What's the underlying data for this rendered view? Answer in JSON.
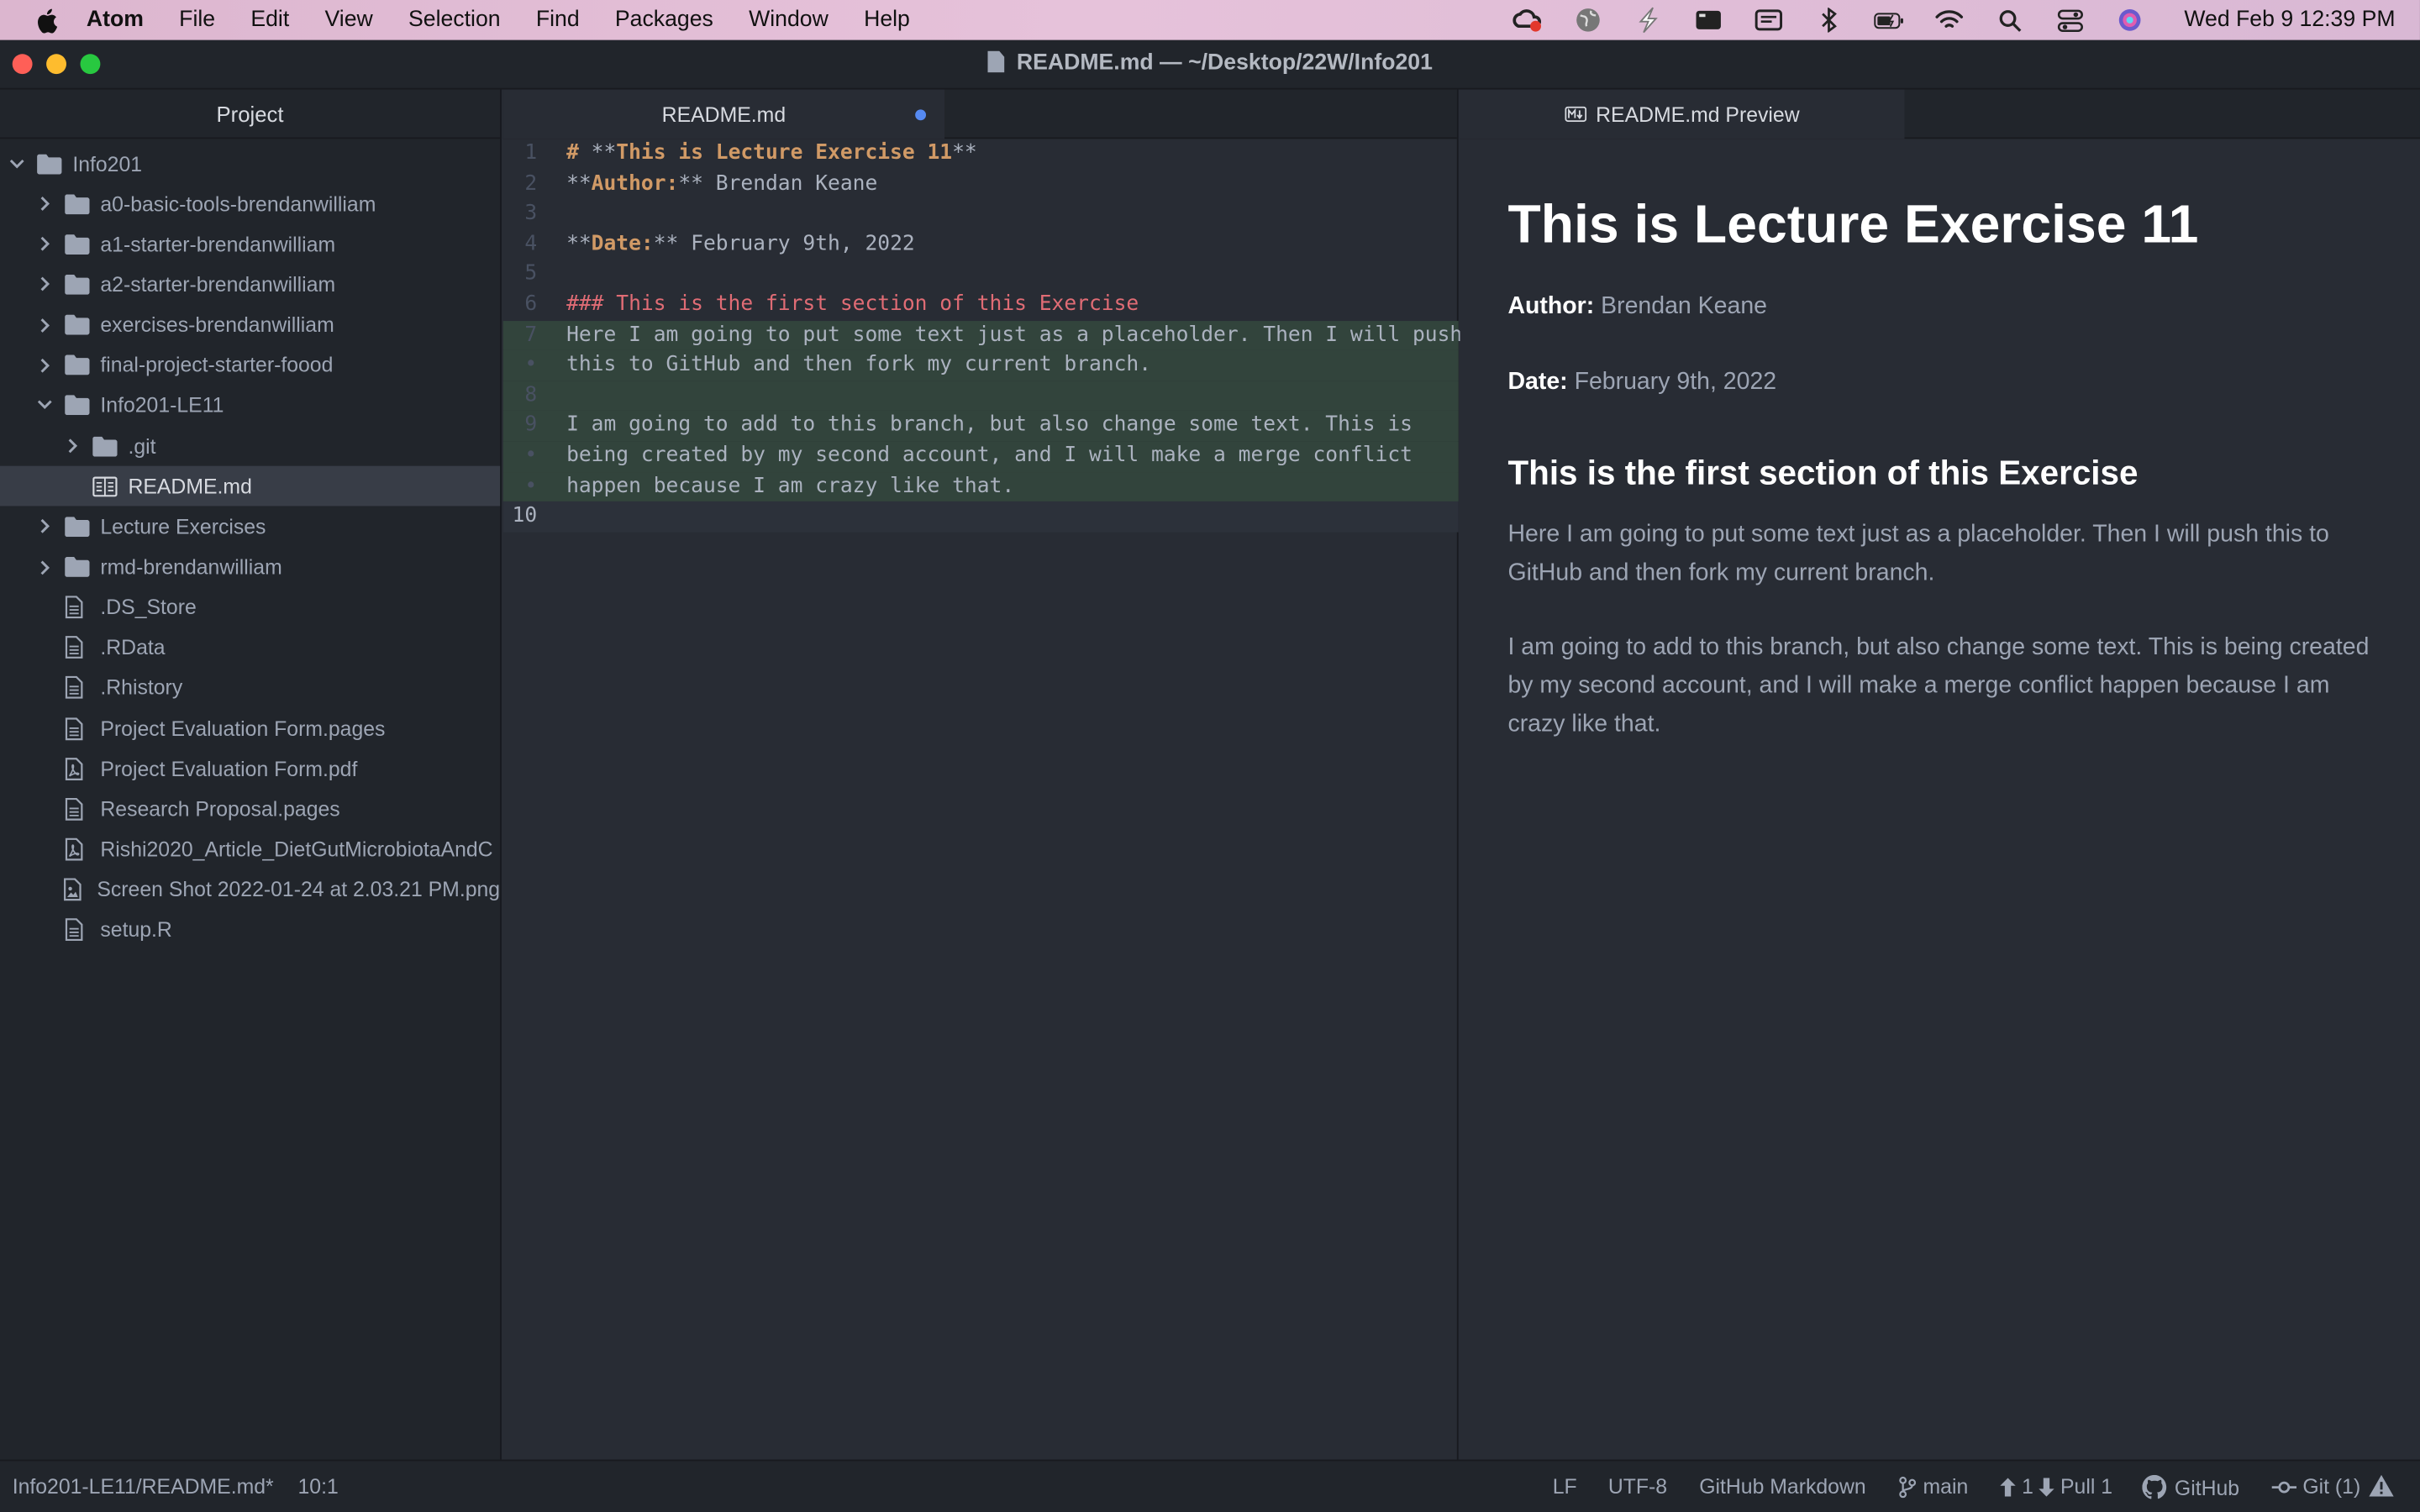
{
  "menubar": {
    "items": [
      "Atom",
      "File",
      "Edit",
      "View",
      "Selection",
      "Find",
      "Packages",
      "Window",
      "Help"
    ],
    "clock": "Wed Feb 9  12:39 PM"
  },
  "window": {
    "title": "README.md — ~/Desktop/22W/Info201"
  },
  "tree": {
    "header": "Project",
    "rows": [
      {
        "label": "Info201",
        "type": "folder-open"
      },
      {
        "label": "a0-basic-tools-brendanwilliam",
        "type": "folder"
      },
      {
        "label": "a1-starter-brendanwilliam",
        "type": "folder"
      },
      {
        "label": "a2-starter-brendanwilliam",
        "type": "folder"
      },
      {
        "label": "exercises-brendanwilliam",
        "type": "folder"
      },
      {
        "label": "final-project-starter-foood",
        "type": "folder"
      },
      {
        "label": "Info201-LE11",
        "type": "folder-open"
      },
      {
        "label": ".git",
        "type": "folder"
      },
      {
        "label": "README.md",
        "type": "markdown-file"
      },
      {
        "label": "Lecture Exercises",
        "type": "folder"
      },
      {
        "label": "rmd-brendanwilliam",
        "type": "folder"
      },
      {
        "label": ".DS_Store",
        "type": "file"
      },
      {
        "label": ".RData",
        "type": "file"
      },
      {
        "label": ".Rhistory",
        "type": "file"
      },
      {
        "label": "Project Evaluation Form.pages",
        "type": "file"
      },
      {
        "label": "Project Evaluation Form.pdf",
        "type": "pdf-file"
      },
      {
        "label": "Research Proposal.pages",
        "type": "file"
      },
      {
        "label": "Rishi2020_Article_DietGutMicrobiotaAndC",
        "type": "pdf-file"
      },
      {
        "label": "Screen Shot 2022-01-24 at 2.03.21 PM.png",
        "type": "image-file"
      },
      {
        "label": "setup.R",
        "type": "file"
      }
    ]
  },
  "editor": {
    "tab_label": "README.md",
    "lines": {
      "l1": {
        "num": "1",
        "a": "# ",
        "b": "**",
        "c": "This is Lecture Exercise 11",
        "d": "**"
      },
      "l2": {
        "num": "2",
        "a": "**",
        "b": "Author:",
        "c": "** Brendan Keane"
      },
      "l3": {
        "num": "3"
      },
      "l4": {
        "num": "4",
        "a": "**",
        "b": "Date:",
        "c": "** February 9th, 2022"
      },
      "l5": {
        "num": "5"
      },
      "l6": {
        "num": "6",
        "a": "### This is the first section of this Exercise"
      },
      "l7": {
        "num": "7",
        "a": "Here I am going to put some text just as a placeholder. Then I will push"
      },
      "l7b": {
        "num": "•",
        "a": "this to GitHub and then fork my current branch."
      },
      "l8": {
        "num": "8"
      },
      "l9": {
        "num": "9",
        "a": "I am going to add to this branch, but also change some text. This is"
      },
      "l9b": {
        "num": "•",
        "a": "being created by my second account, and I will make a merge conflict"
      },
      "l9c": {
        "num": "•",
        "a": "happen because I am crazy like that."
      },
      "l10": {
        "num": "10"
      }
    }
  },
  "preview": {
    "tab_label": "README.md Preview",
    "title": "This is Lecture Exercise 11",
    "author_label": "Author:",
    "author_value": " Brendan Keane",
    "date_label": "Date:",
    "date_value": " February 9th, 2022",
    "section_heading": "This is the first section of this Exercise",
    "para1": "Here I am going to put some text just as a placeholder. Then I will push this to GitHub and then fork my current branch.",
    "para2": "I am going to add to this branch, but also change some text. This is being created by my second account, and I will make a merge conflict happen because I am crazy like that."
  },
  "statusbar": {
    "file_path": "Info201-LE11/README.md*",
    "cursor": "10:1",
    "line_ending": "LF",
    "encoding": "UTF-8",
    "grammar": "GitHub Markdown",
    "branch": "main",
    "ahead": "1",
    "pull": "Pull 1",
    "github": "GitHub",
    "git": "Git (1)"
  }
}
